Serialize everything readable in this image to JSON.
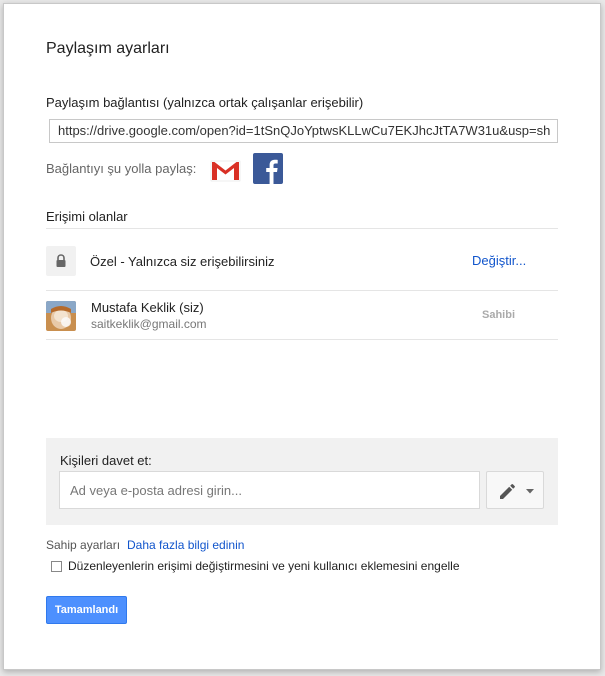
{
  "dialog": {
    "title": "Paylaşım ayarları",
    "link_label": "Paylaşım bağlantısı (yalnızca ortak çalışanlar erişebilir)",
    "link_value": "https://drive.google.com/open?id=1tSnQJoYptwsKLLwCu7EKJhcJtTA7W31u&usp=sh",
    "share_via_label": "Bağlantıyı şu yolla paylaş:",
    "share_icons": [
      "gmail-icon",
      "facebook-icon"
    ],
    "access_title": "Erişimi olanlar",
    "privacy": {
      "icon": "lock-icon",
      "text": "Özel - Yalnızca siz erişebilirsiniz",
      "change_label": "Değiştir..."
    },
    "people": [
      {
        "name": "Mustafa Keklik (siz)",
        "email": "saitkeklik@gmail.com",
        "role": "Sahibi"
      }
    ],
    "invite": {
      "label": "Kişileri davet et:",
      "placeholder": "Ad veya e-posta adresi girin...",
      "permission_icon": "pencil-icon"
    },
    "owner_settings_label": "Sahip ayarları",
    "learn_more_label": "Daha fazla bilgi edinin",
    "restrict_checkbox_label": "Düzenleyenlerin erişimi değiştirmesini ve yeni kullanıcı eklemesini engelle",
    "restrict_checked": false,
    "done_label": "Tamamlandı"
  },
  "colors": {
    "link": "#1155cc",
    "primary_button": "#4d90fe",
    "facebook": "#3b5998",
    "gmail_red": "#d93025"
  }
}
